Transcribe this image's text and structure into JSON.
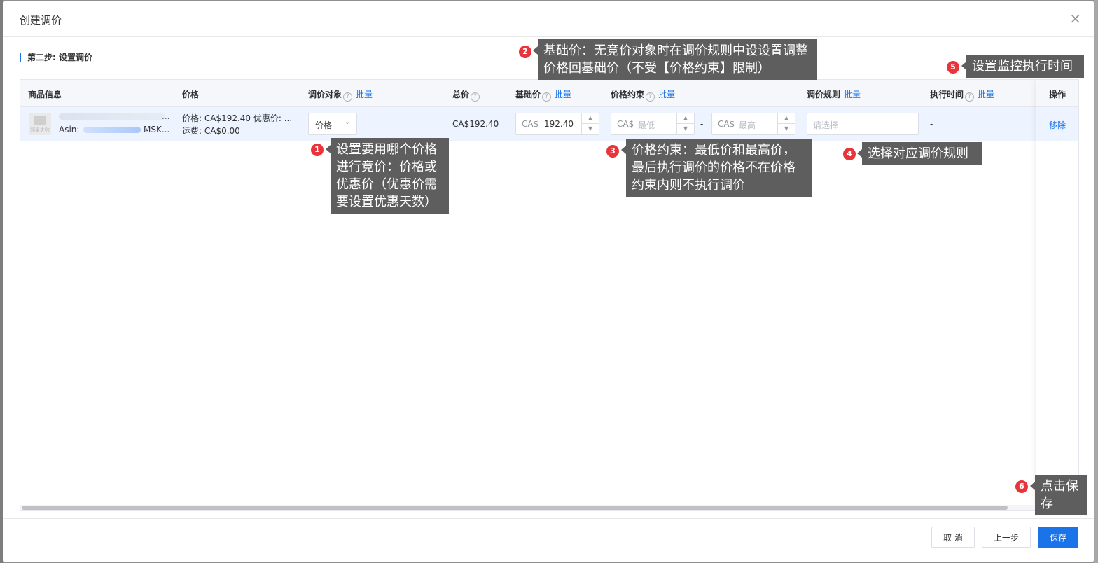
{
  "modal": {
    "title": "创建调价",
    "close_symbol": "×"
  },
  "step": {
    "title": "第二步: 设置调价"
  },
  "columns": {
    "product": "商品信息",
    "price": "价格",
    "target": "调价对象",
    "total": "总价",
    "base": "基础价",
    "constraint": "价格约束",
    "rule": "调价规则",
    "exec_time": "执行时间",
    "action": "操作",
    "batch": "批量",
    "help_symbol": "?"
  },
  "row": {
    "thumb_label": "领星失败",
    "asin_label": "Asin:",
    "asin_tail": "MSK...",
    "name_ellipsis": "...",
    "price_line": "价格: CA$192.40 优惠价: ...",
    "shipping_line": "运费: CA$0.00",
    "target_value": "价格",
    "total": "CA$192.40",
    "currency": "CA$",
    "base_value": "192.40",
    "min_placeholder": "最低",
    "max_placeholder": "最高",
    "range_sep": "-",
    "rule_placeholder": "请选择",
    "exec_time": "-",
    "remove": "移除"
  },
  "buttons": {
    "cancel": "取 消",
    "prev": "上一步",
    "save": "保存"
  },
  "annotations": [
    {
      "num": "1",
      "text": "设置要用哪个价格进行竞价：价格或优惠价（优惠价需要设置优惠天数）"
    },
    {
      "num": "2",
      "text": "基础价：无竞价对象时在调价规则中设设置调整价格回基础价（不受【价格约束】限制）"
    },
    {
      "num": "3",
      "text": "价格约束：最低价和最高价，最后执行调价的价格不在价格约束内则不执行调价"
    },
    {
      "num": "4",
      "text": "选择对应调价规则"
    },
    {
      "num": "5",
      "text": "设置监控执行时间"
    },
    {
      "num": "6",
      "text": "点击保存"
    }
  ],
  "colors": {
    "primary": "#1a73e8",
    "callout_bg": "#5e5e5e",
    "badge": "#e8343a",
    "row_highlight": "#eef4ff"
  },
  "icons": {
    "close": "close-icon",
    "help": "question-circle-icon",
    "dropdown": "chevron-down-icon",
    "spinner": "spinner-arrows-icon"
  }
}
